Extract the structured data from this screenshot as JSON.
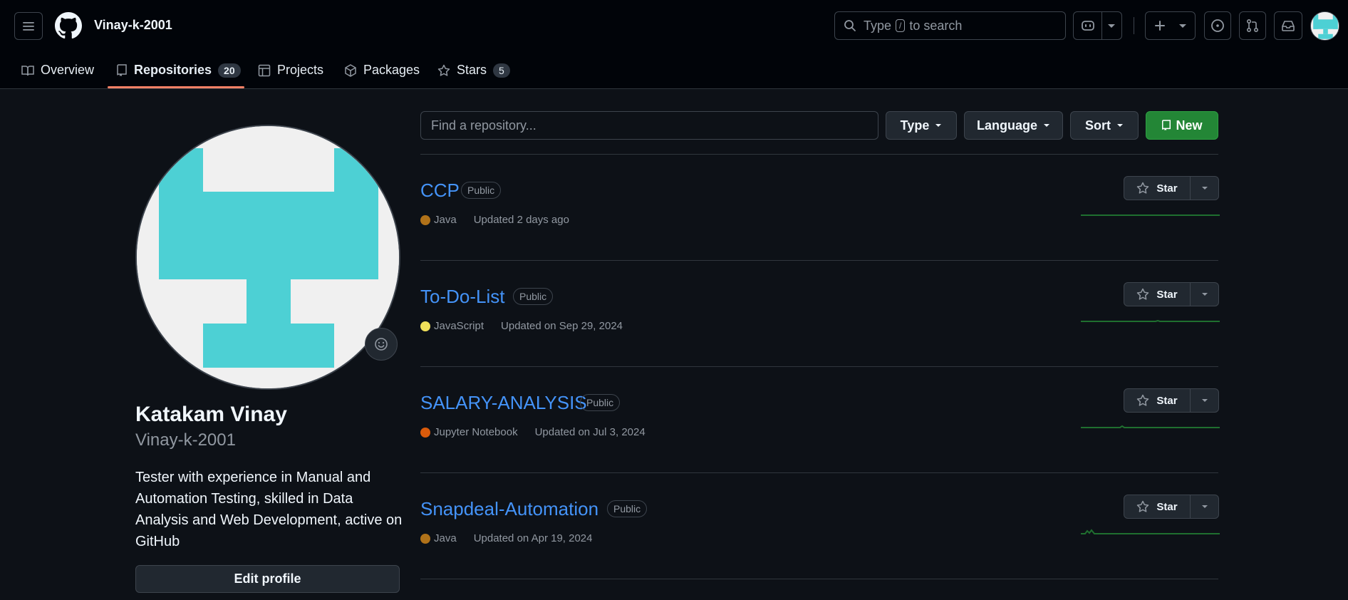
{
  "header": {
    "username": "Vinay-k-2001",
    "search": {
      "prefix": "Type",
      "key": "/",
      "suffix": "to search"
    }
  },
  "tabs": [
    {
      "label": "Overview",
      "icon": "book-icon"
    },
    {
      "label": "Repositories",
      "icon": "repo-icon",
      "count": "20",
      "active": true
    },
    {
      "label": "Projects",
      "icon": "table-icon"
    },
    {
      "label": "Packages",
      "icon": "package-icon"
    },
    {
      "label": "Stars",
      "icon": "star-icon",
      "count": "5"
    }
  ],
  "profile": {
    "name": "Katakam Vinay",
    "login": "Vinay-k-2001",
    "bio": "Tester with experience in Manual and Automation Testing, skilled in Data Analysis and Web Development, active on GitHub",
    "edit_label": "Edit profile",
    "avatar_color": "#4dd0d4"
  },
  "filters": {
    "find_placeholder": "Find a repository...",
    "type_label": "Type",
    "language_label": "Language",
    "sort_label": "Sort",
    "new_label": "New"
  },
  "repos": [
    {
      "name": "CCP",
      "visibility": "Public",
      "language": "Java",
      "lang_color": "#b07219",
      "updated": "Updated 2 days ago",
      "star_label": "Star"
    },
    {
      "name": "To-Do-List",
      "visibility": "Public",
      "language": "JavaScript",
      "lang_color": "#f1e05a",
      "updated": "Updated on Sep 29, 2024",
      "star_label": "Star"
    },
    {
      "name": "SALARY-ANALYSIS",
      "visibility": "Public",
      "language": "Jupyter Notebook",
      "lang_color": "#DA5B0B",
      "updated": "Updated on Jul 3, 2024",
      "star_label": "Star"
    },
    {
      "name": "Snapdeal-Automation",
      "visibility": "Public",
      "language": "Java",
      "lang_color": "#b07219",
      "updated": "Updated on Apr 19, 2024",
      "star_label": "Star"
    }
  ],
  "colors": {
    "accent_tab": "#f78166",
    "link": "#4493f8",
    "new_button": "#238636",
    "sparkline": "#1f6f2f"
  }
}
